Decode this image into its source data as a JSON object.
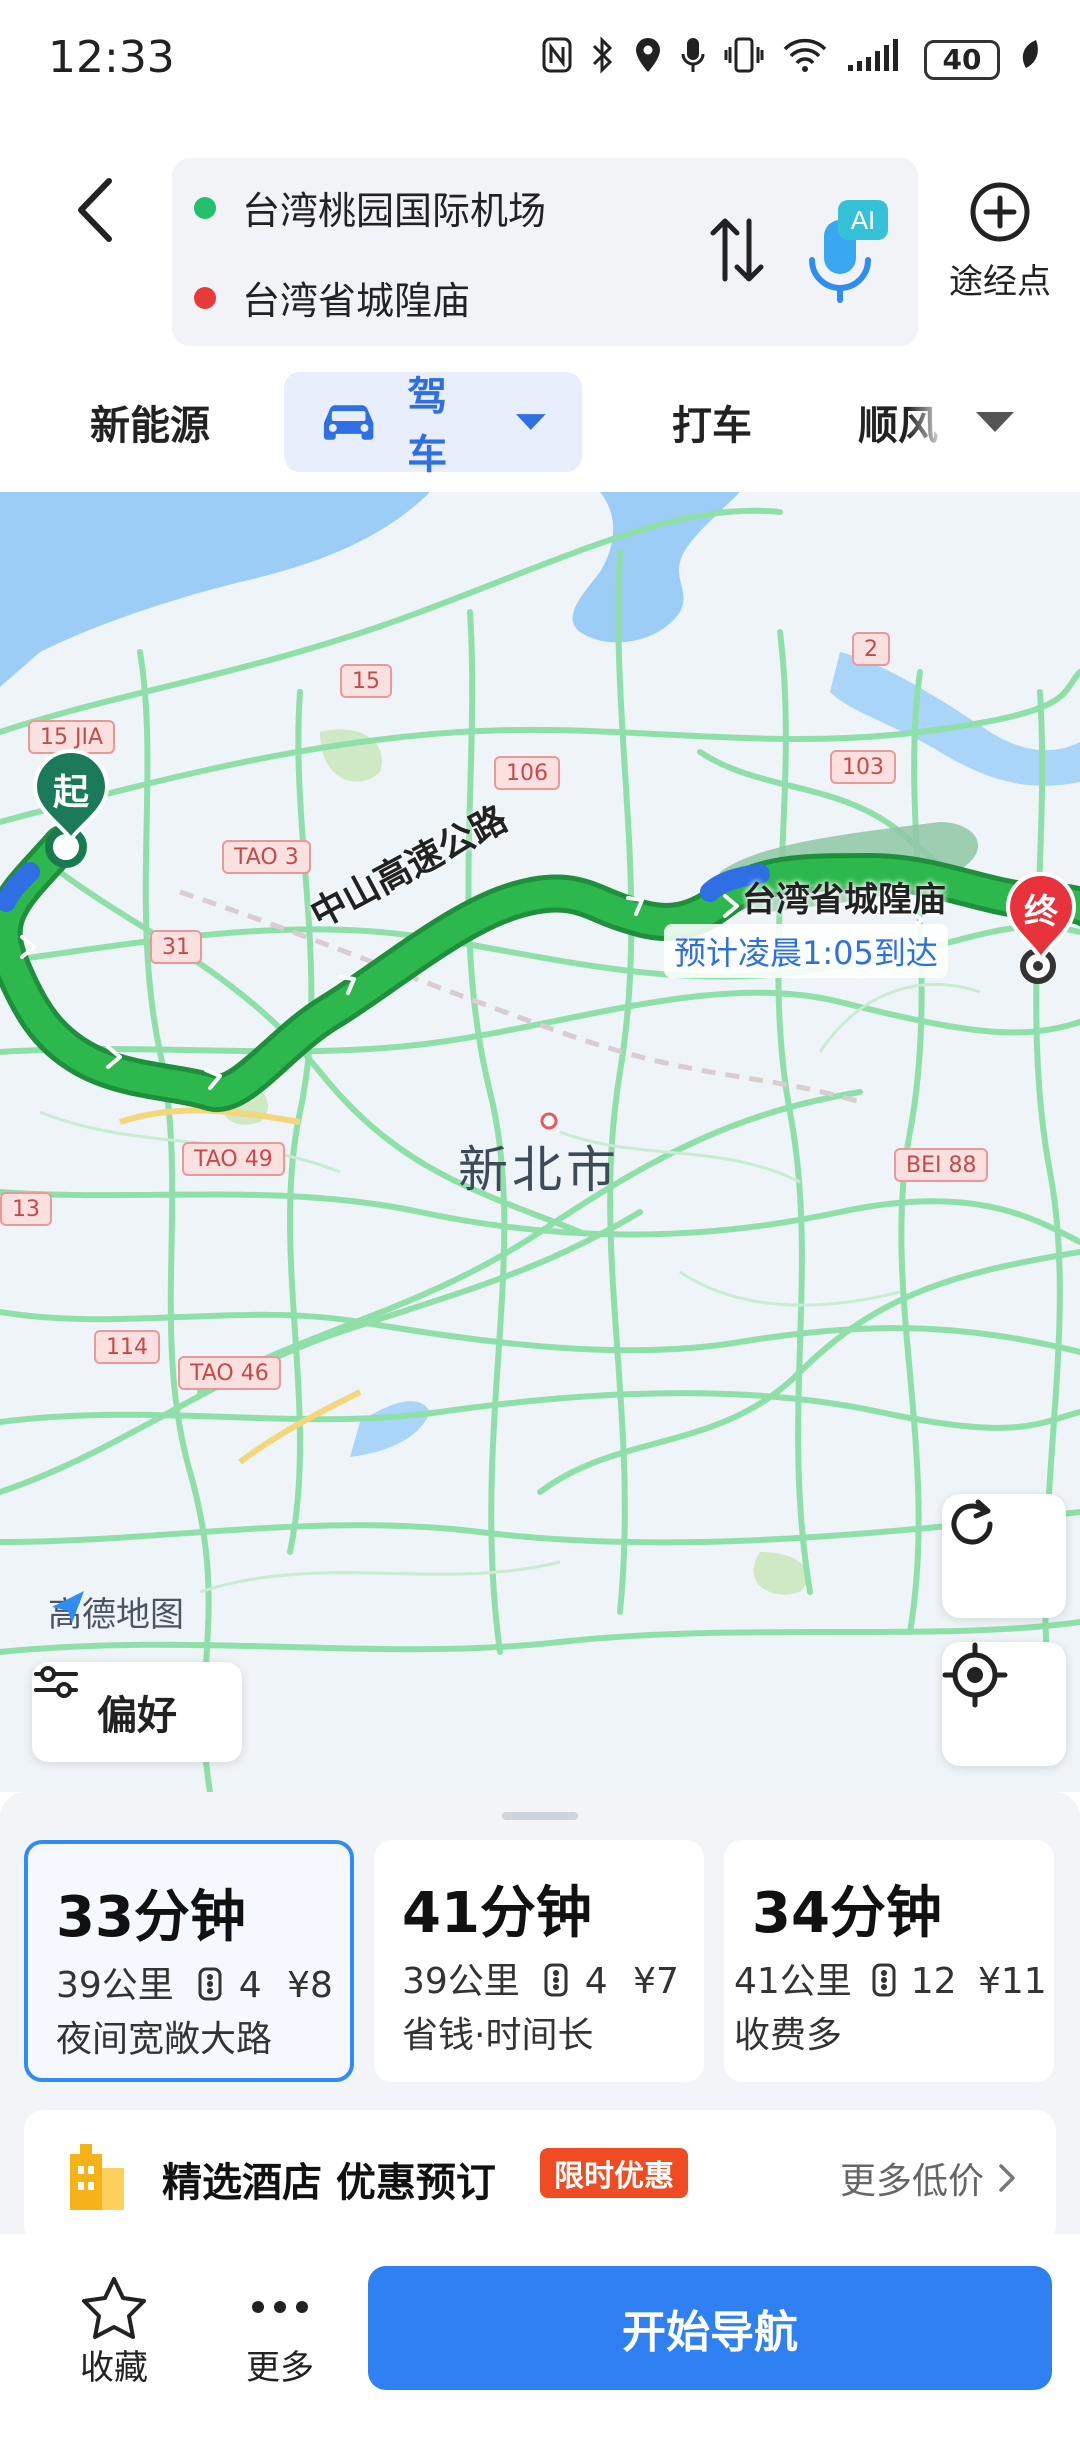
{
  "status_bar": {
    "time": "12:33",
    "battery": "40"
  },
  "route": {
    "origin": "台湾桃园国际机场",
    "destination": "台湾省城隍庙",
    "waypoint_label": "途经点",
    "ai_badge": "AI"
  },
  "modes": {
    "items": [
      "新能源",
      "驾车",
      "打车",
      "顺风"
    ],
    "active": "驾车"
  },
  "map": {
    "city_label": "新北市",
    "road_name": "中山高速公路",
    "dest_label": "台湾省城隍庙",
    "eta": "预计凌晨1:05到达",
    "start_marker": "起",
    "end_marker": "终",
    "brand": "高德地图",
    "preference_label": "偏好",
    "road_badges": [
      "15 JIA",
      "15",
      "106",
      "103",
      "2",
      "TAO 3",
      "31",
      "TAO 49",
      "BEI 88",
      "13",
      "114",
      "TAO 46"
    ],
    "route_color": "#2db84d",
    "road_color": "#8fe0a8"
  },
  "routes": [
    {
      "time": "33分钟",
      "distance": "39公里",
      "lights": "4",
      "cost": "¥8",
      "tag": "夜间宽敞大路",
      "selected": true
    },
    {
      "time": "41分钟",
      "distance": "39公里",
      "lights": "4",
      "cost": "¥7",
      "tag": "省钱·时间长",
      "selected": false
    },
    {
      "time": "34分钟",
      "distance": "41公里",
      "lights": "12",
      "cost": "¥11",
      "tag": "收费多",
      "selected": false
    }
  ],
  "hotel": {
    "title": "精选酒店 优惠预订",
    "badge": "限时优惠",
    "more": "更多低价"
  },
  "actions": {
    "favorite": "收藏",
    "more": "更多",
    "start": "开始导航"
  }
}
